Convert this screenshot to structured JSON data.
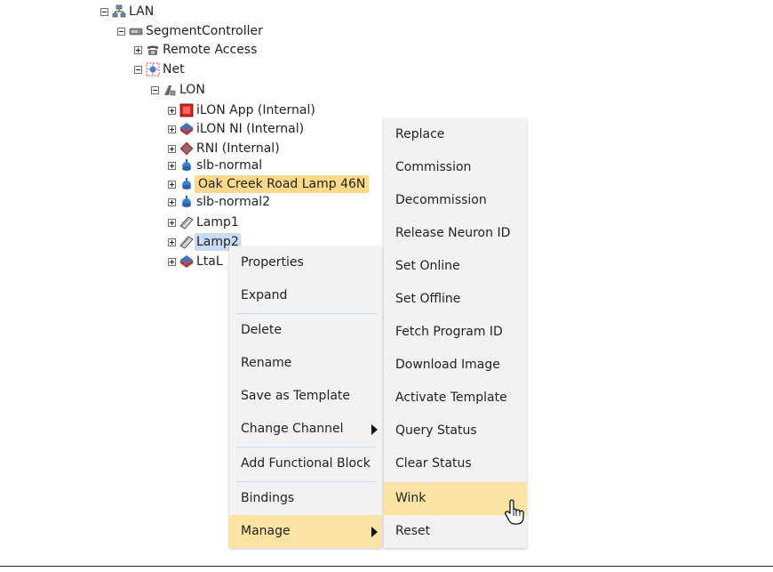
{
  "tree": {
    "nodes": [
      {
        "label": "LAN",
        "icon": "network-icon"
      },
      {
        "label": "SegmentController",
        "icon": "controller-icon"
      },
      {
        "label": "Remote Access",
        "icon": "phone-icon"
      },
      {
        "label": "Net",
        "icon": "net-icon"
      },
      {
        "label": "LON",
        "icon": "lon-icon"
      },
      {
        "label": "iLON App (Internal)",
        "icon": "ilon-app-icon"
      },
      {
        "label": "iLON NI (Internal)",
        "icon": "ilon-ni-icon"
      },
      {
        "label": "RNI (Internal)",
        "icon": "rni-icon"
      },
      {
        "label": "slb-normal",
        "icon": "streetlight-icon"
      },
      {
        "label": "Oak Creek Road Lamp 46N",
        "icon": "streetlight-icon"
      },
      {
        "label": "slb-normal2",
        "icon": "streetlight-icon"
      },
      {
        "label": "Lamp1",
        "icon": "lamp-device-icon"
      },
      {
        "label": "Lamp2",
        "icon": "lamp-device-icon"
      },
      {
        "label": "LtaL",
        "icon": "lta-icon"
      }
    ]
  },
  "context_menu": {
    "items": [
      {
        "label": "Properties"
      },
      {
        "label": "Expand"
      },
      {
        "label": "Delete"
      },
      {
        "label": "Rename"
      },
      {
        "label": "Save as Template"
      },
      {
        "label": "Change Channel"
      },
      {
        "label": "Add Functional Block"
      },
      {
        "label": "Bindings"
      },
      {
        "label": "Manage"
      }
    ],
    "active_item": "Manage"
  },
  "manage_submenu": {
    "items": [
      {
        "label": "Replace"
      },
      {
        "label": "Commission"
      },
      {
        "label": "Decommission"
      },
      {
        "label": "Release Neuron ID"
      },
      {
        "label": "Set Online"
      },
      {
        "label": "Set Offline"
      },
      {
        "label": "Fetch Program ID"
      },
      {
        "label": "Download Image"
      },
      {
        "label": "Activate Template"
      },
      {
        "label": "Query Status"
      },
      {
        "label": "Clear Status"
      },
      {
        "label": "Wink"
      },
      {
        "label": "Reset"
      }
    ],
    "hovered_item": "Wink"
  },
  "colors": {
    "highlight_orange": "#fbd98a",
    "highlight_blue": "#c9dcf5",
    "menu_background": "#f2f2f2",
    "menu_active": "#fbe4a3"
  }
}
